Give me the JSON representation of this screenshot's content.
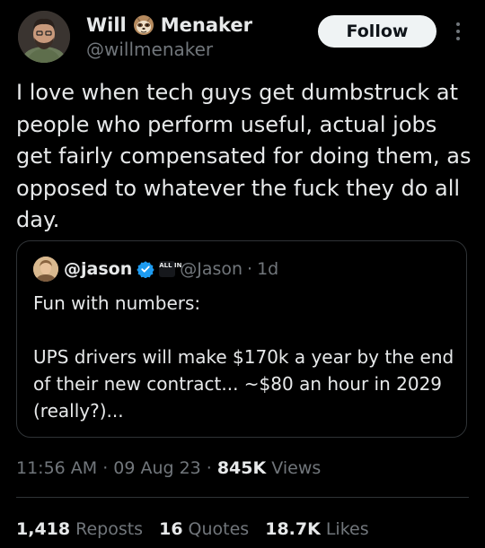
{
  "author": {
    "name_first": "Will",
    "name_emoji": "sloth-emoji",
    "name_last": "Menaker",
    "handle": "@willmenaker",
    "follow_label": "Follow"
  },
  "tweet": {
    "text": "I love when tech guys get dumbstruck at people who perform useful, actual jobs get fairly compensated for doing them, as opposed to whatever the fuck they do all day."
  },
  "quote": {
    "name": "@jason",
    "badge_text": "ALL IN",
    "handle": "@Jason",
    "separator": "·",
    "time": "1d",
    "text": "Fun with numbers:\n\nUPS drivers will make $170k a year by the end of their new contract... ~$80 an hour in 2029 (really?)..."
  },
  "meta": {
    "time": "11:56 AM",
    "sep1": "·",
    "date": "09 Aug 23",
    "sep2": "·",
    "views_count": "845K",
    "views_label": "Views"
  },
  "stats": {
    "reposts_count": "1,418",
    "reposts_label": "Reposts",
    "quotes_count": "16",
    "quotes_label": "Quotes",
    "likes_count": "18.7K",
    "likes_label": "Likes"
  },
  "colors": {
    "background": "#000000",
    "text": "#e7e9ea",
    "secondary_text": "#71767b",
    "border": "#2f3336",
    "verified_blue": "#1d9bf0",
    "follow_button_bg": "#eff3f4"
  }
}
